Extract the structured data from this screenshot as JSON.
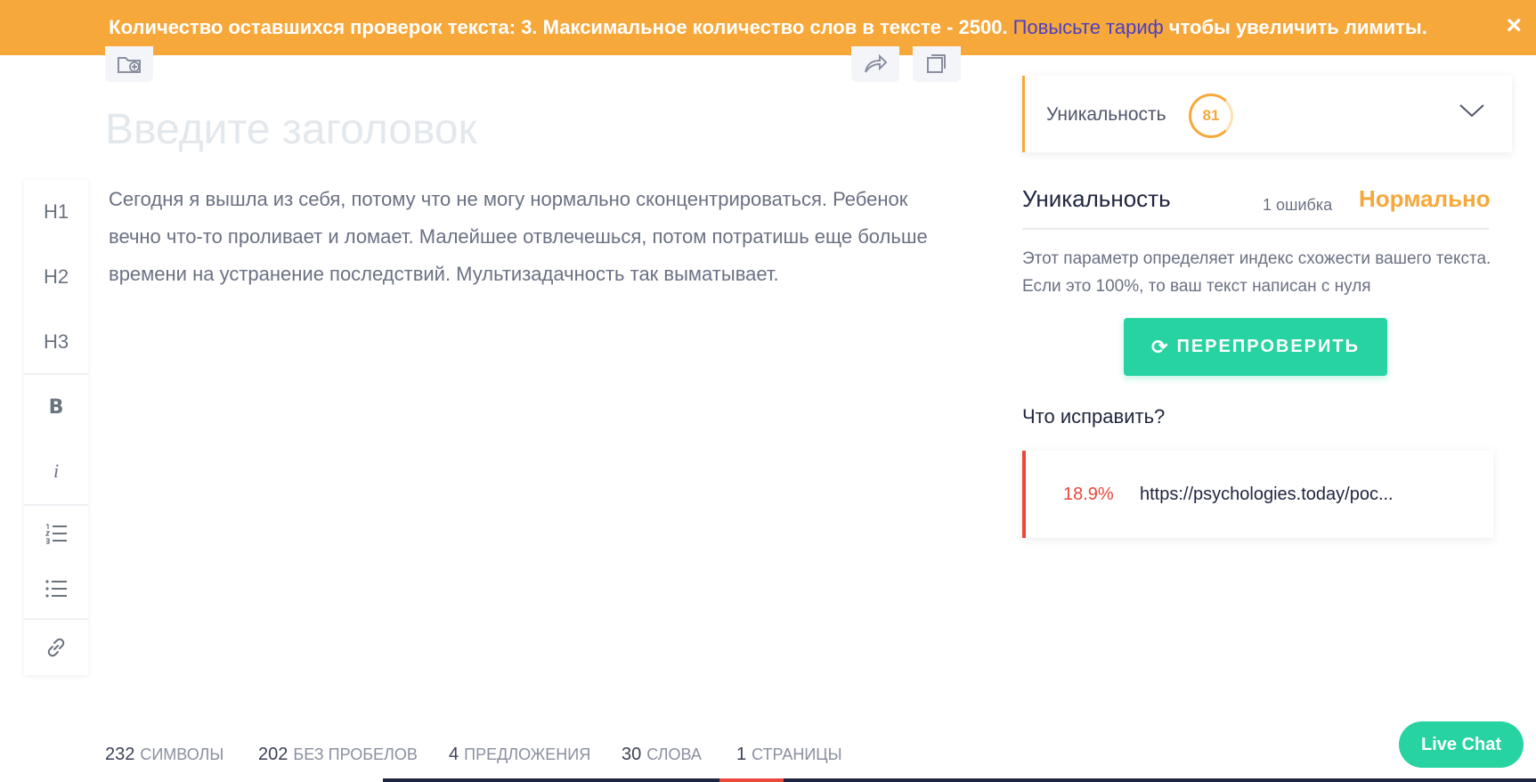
{
  "banner": {
    "prefix": "Количество оставшихся проверок текста: 3. Максимальное количество слов в тексте - 2500.",
    "link": "Повысьте тариф",
    "suffix": "чтобы увеличить лимиты.",
    "close": "×"
  },
  "editor": {
    "title_placeholder": "Введите заголовок",
    "body": "Сегодня я вышла из себя, потому что не могу нормально сконцентрироваться. Ребенок вечно что-то проливает и ломает. Малейшее отвлечешься, потом потратишь еще больше времени на устранение последствий. Мультизадачность так выматывает."
  },
  "toolbar": {
    "h1": "H1",
    "h2": "H2",
    "h3": "H3",
    "bold": "B",
    "italic": "i"
  },
  "panel": {
    "card_label": "Уникальность",
    "score": "81",
    "section_title": "Уникальность",
    "errors": "1 ошибка",
    "status": "Нормально",
    "description": "Этот параметр определяет индекс схожести вашего текста. Если это 100%, то ваш текст написан с нуля",
    "recheck_label": "ПЕРЕПРОВЕРИТЬ",
    "fix_title": "Что исправить?",
    "fix_items": [
      {
        "percent": "18.9%",
        "url": "https://psychologies.today/poc..."
      }
    ]
  },
  "stats": [
    {
      "num": "232",
      "label": "СИМВОЛЫ"
    },
    {
      "num": "202",
      "label": "БЕЗ ПРОБЕЛОВ"
    },
    {
      "num": "4",
      "label": "ПРЕДЛОЖЕНИЯ"
    },
    {
      "num": "30",
      "label": "СЛОВА"
    },
    {
      "num": "1",
      "label": "СТРАНИЦЫ"
    }
  ],
  "livechat": "Live Chat",
  "colors": {
    "accent_orange": "#f7a83a",
    "accent_green": "#27d3a1",
    "error_red": "#e9483a",
    "link_purple": "#4a3fc4"
  }
}
